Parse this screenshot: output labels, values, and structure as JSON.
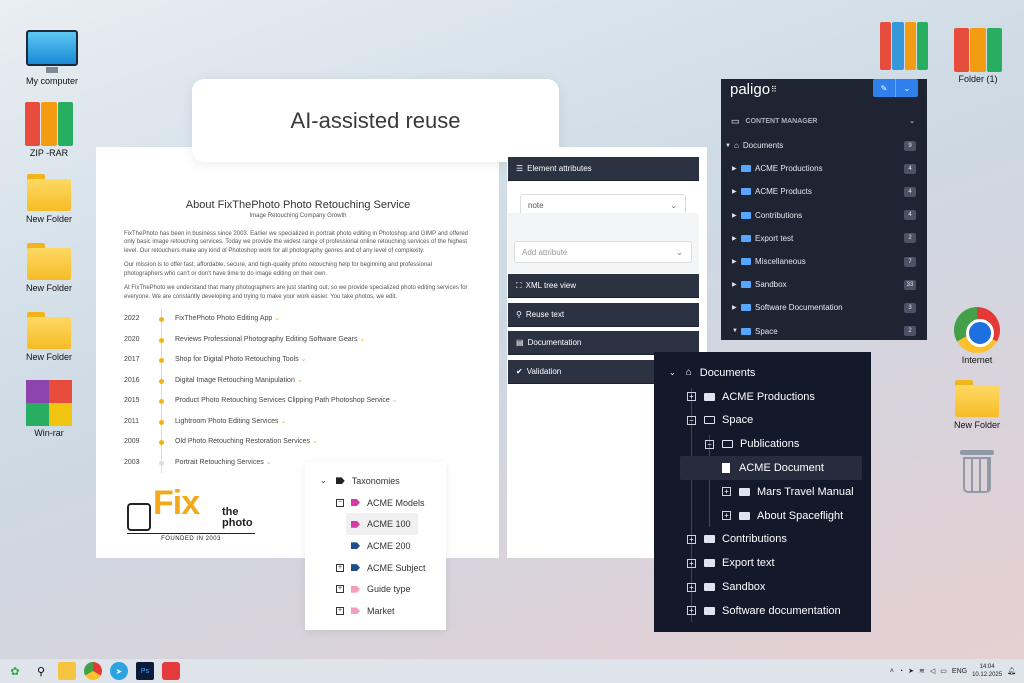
{
  "desktop": {
    "left_icons": [
      {
        "label": "My computer",
        "icon": "monitor-icon"
      },
      {
        "label": "ZIP -RAR",
        "icon": "binders-icon"
      },
      {
        "label": "New Folder",
        "icon": "folder-icon"
      },
      {
        "label": "New Folder",
        "icon": "folder-icon"
      },
      {
        "label": "New Folder",
        "icon": "folder-icon"
      },
      {
        "label": "Win-rar",
        "icon": "winrar-icon"
      }
    ],
    "right_icons": [
      {
        "label": "Folder (1)",
        "icon": "binders-icon"
      },
      {
        "label": "Internet",
        "icon": "chrome-icon"
      },
      {
        "label": "New Folder",
        "icon": "folder-icon"
      },
      {
        "label": "",
        "icon": "recycle-bin-icon"
      }
    ]
  },
  "headline": "AI-assisted reuse",
  "article": {
    "title": "About FixThePhoto Photo Retouching Service",
    "subtitle": "Image Retouching Company Growth",
    "paragraphs": [
      "FixThePhoto has been in business since 2003. Earlier we specialized in portrait photo editing in Photoshop and GIMP and offered only basic image retouching services. Today we provide the widest range of professional online retouching services of the highest level. Our retouchers make any kind of Photoshop work for all photography genres and of any level of complexity.",
      "Our mission is to offer fast, affordable, secure, and high-quality photo retouching help for beginning and professional photographers who can't or don't have time to do image editing on their own.",
      "At FixThePhoto we understand that many photographers are just starting out, so we provide specialized photo editing services for everyone. We are constantly developing and trying to make your work easier. You take photos, we edit."
    ],
    "timeline": [
      {
        "year": "2022",
        "text": "FixThePhoto Photo Editing App"
      },
      {
        "year": "2020",
        "text": "Reviews Professional Photography Editing Software Gears"
      },
      {
        "year": "2017",
        "text": "Shop for Digital Photo Retouching Tools"
      },
      {
        "year": "2016",
        "text": "Digital Image Retouching Manipulation"
      },
      {
        "year": "2015",
        "text": "Product Photo Retouching Services Clipping Path Photoshop Service"
      },
      {
        "year": "2011",
        "text": "Lightroom Photo Editing Services"
      },
      {
        "year": "2009",
        "text": "Old Photo Retouching Restoration Services"
      },
      {
        "year": "2003",
        "text": "Portrait Retouching Services"
      }
    ],
    "logo": {
      "fix": "Fix",
      "the": "the",
      "photo": "photo",
      "founded": "FOUNDED IN 2003"
    }
  },
  "attributes_panel": {
    "header": "Element attributes",
    "select_value": "note",
    "add_placeholder": "Add attribute",
    "sections": [
      "XML tree view",
      "Reuse text",
      "Documentation",
      "Validation"
    ]
  },
  "paligo": {
    "brand": "paligo",
    "section": "CONTENT MANAGER",
    "root": {
      "label": "Documents",
      "count": "9"
    },
    "items": [
      {
        "label": "ACME Productions",
        "count": "4"
      },
      {
        "label": "ACME Products",
        "count": "4"
      },
      {
        "label": "Contributions",
        "count": "4"
      },
      {
        "label": "Export test",
        "count": "2"
      },
      {
        "label": "Miscellaneous",
        "count": "7"
      },
      {
        "label": "Sandbox",
        "count": "33"
      },
      {
        "label": "Software Documentation",
        "count": "3"
      },
      {
        "label": "Space",
        "count": "2"
      }
    ]
  },
  "tree": {
    "root": "Documents",
    "items": [
      {
        "label": "ACME Productions",
        "level": 1,
        "kind": "folder",
        "box": "+"
      },
      {
        "label": "Space",
        "level": 1,
        "kind": "folder-open",
        "box": "−"
      },
      {
        "label": "Publications",
        "level": 2,
        "kind": "folder-open",
        "box": "−"
      },
      {
        "label": "ACME Document",
        "level": 2,
        "kind": "document",
        "box": ""
      },
      {
        "label": "Mars Travel Manual",
        "level": 3,
        "kind": "folder",
        "box": "+"
      },
      {
        "label": "About Spaceflight",
        "level": 3,
        "kind": "folder",
        "box": "+"
      },
      {
        "label": "Contributions",
        "level": 1,
        "kind": "folder",
        "box": "+"
      },
      {
        "label": "Export text",
        "level": 1,
        "kind": "folder",
        "box": "+"
      },
      {
        "label": "Sandbox",
        "level": 1,
        "kind": "folder",
        "box": "+"
      },
      {
        "label": "Software documentation",
        "level": 1,
        "kind": "folder",
        "box": "+"
      }
    ]
  },
  "taxonomies": {
    "root": "Taxonomies",
    "items": [
      {
        "label": "ACME Models",
        "level": 1,
        "box": "−",
        "color": "#d63aa5"
      },
      {
        "label": "ACME 100",
        "level": 2,
        "box": "",
        "color": "#d63aa5"
      },
      {
        "label": "ACME 200",
        "level": 2,
        "box": "",
        "color": "#1f4e8c"
      },
      {
        "label": "ACME Subject",
        "level": 1,
        "box": "+",
        "color": "#1f4e8c"
      },
      {
        "label": "Guide type",
        "level": 1,
        "box": "+",
        "color": "#f2a0b8"
      },
      {
        "label": "Market",
        "level": 1,
        "box": "+",
        "color": "#f2a0b8"
      }
    ]
  },
  "taskbar": {
    "language": "ENG",
    "time": "14:04",
    "date": "10.12.2025"
  }
}
